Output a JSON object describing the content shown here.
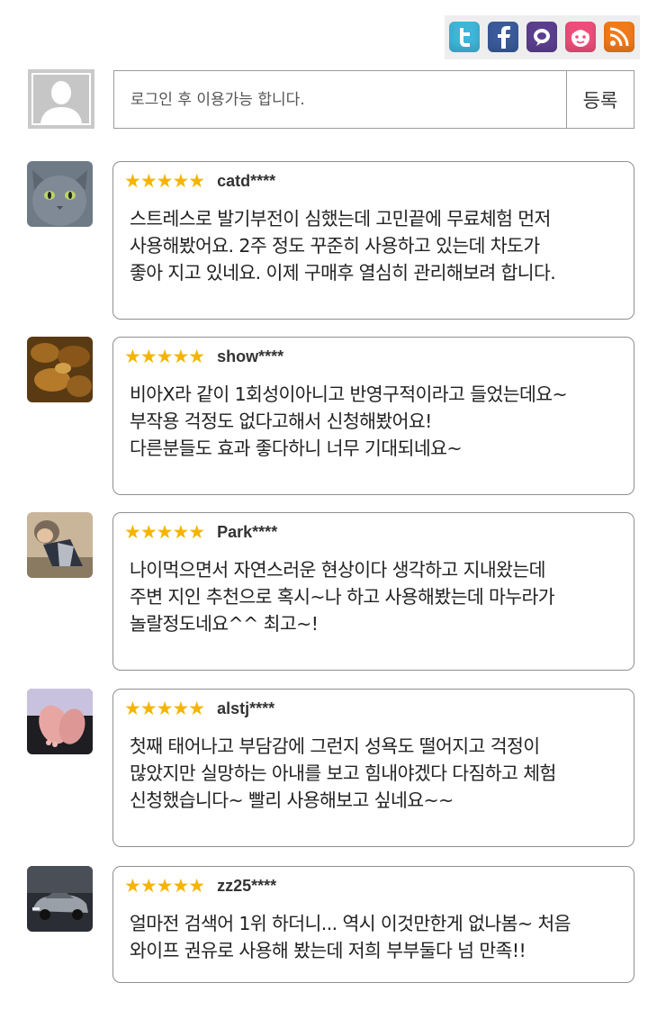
{
  "share": {
    "buttons": [
      {
        "icon": "twitter-icon",
        "color": "#3fb5d8"
      },
      {
        "icon": "facebook-icon",
        "color": "#3a5a9a"
      },
      {
        "icon": "me2day-icon",
        "color": "#5b3f8e"
      },
      {
        "icon": "cyworld-icon",
        "color": "#ee4d7a"
      },
      {
        "icon": "rss-icon",
        "color": "#f07a1a"
      }
    ]
  },
  "comment_form": {
    "placeholder": "로그인 후 이용가능 합니다.",
    "submit_label": "등록"
  },
  "reviews": [
    {
      "stars": "★★★★★",
      "user": "catd****",
      "text": "스트레스로 발기부전이 심했는데 고민끝에 무료체험 먼저\n사용해봤어요. 2주 정도 꾸준히 사용하고 있는데 차도가\n좋아 지고 있네요. 이제 구매후 열심히 관리해보려 합니다."
    },
    {
      "stars": "★★★★★",
      "user": "show****",
      "text": "비아X라 같이 1회성이아니고 반영구적이라고 들었는데요~\n부작용 걱정도 없다고해서 신청해봤어요!\n다른분들도 효과 좋다하니 너무 기대되네요~"
    },
    {
      "stars": "★★★★★",
      "user": "Park****",
      "text": "나이먹으면서 자연스러운 현상이다 생각하고 지내왔는데\n주변 지인 추천으로 혹시~나 하고 사용해봤는데 마누라가\n놀랄정도네요^^ 최고~!"
    },
    {
      "stars": "★★★★★",
      "user": "alstj****",
      "text": "첫째 태어나고 부담감에 그런지 성욕도 떨어지고 걱정이\n많았지만 실망하는 아내를 보고 힘내야겠다 다짐하고 체험\n신청했습니다~ 빨리 사용해보고 싶네요~~"
    },
    {
      "stars": "★★★★★",
      "user": "zz25****",
      "text": "얼마전 검색어 1위 하더니... 역시 이것만한게 없나봄~ 처음\n와이프 권유로 사용해 봤는데 저희 부부둘다 넘 만족!!"
    }
  ],
  "colors": {
    "star": "#f5b400",
    "border": "#8f8f8f"
  }
}
